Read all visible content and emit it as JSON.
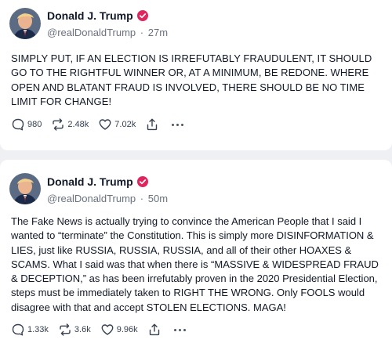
{
  "colors": {
    "background": "#eef0f3",
    "card": "#ffffff",
    "verified_badge": "#e0245e",
    "text": "#111827",
    "muted": "#6b7280"
  },
  "posts": [
    {
      "display_name": "Donald J. Trump",
      "handle": "@realDonaldTrump",
      "separator": "·",
      "time_ago": "27m",
      "text": "SIMPLY PUT, IF AN ELECTION IS IRREFUTABLY FRAUDULENT, IT SHOULD GO TO THE RIGHTFUL WINNER OR, AT A MINIMUM, BE REDONE. WHERE OPEN AND BLATANT FRAUD IS INVOLVED, THERE SHOULD BE NO TIME LIMIT FOR CHANGE!",
      "replies": "980",
      "retruths": "2.48k",
      "likes": "7.02k",
      "icons": [
        "reply-icon",
        "retruth-icon",
        "like-icon",
        "share-icon",
        "more-icon"
      ]
    },
    {
      "display_name": "Donald J. Trump",
      "handle": "@realDonaldTrump",
      "separator": "·",
      "time_ago": "50m",
      "text": "The Fake News is actually trying to convince the American People that I said I wanted to “terminate” the Constitution. This is simply more DISINFORMATION & LIES, just like RUSSIA, RUSSIA, RUSSIA, and all of their other HOAXES & SCAMS. What I said was that when there is “MASSIVE & WIDESPREAD FRAUD & DECEPTION,” as has been irrefutably proven in the 2020 Presidential Election, steps must be immediately taken to RIGHT THE WRONG. Only FOOLS would disagree with that and accept STOLEN ELECTIONS. MAGA!",
      "replies": "1.33k",
      "retruths": "3.6k",
      "likes": "9.96k",
      "icons": [
        "reply-icon",
        "retruth-icon",
        "like-icon",
        "share-icon",
        "more-icon"
      ]
    }
  ]
}
